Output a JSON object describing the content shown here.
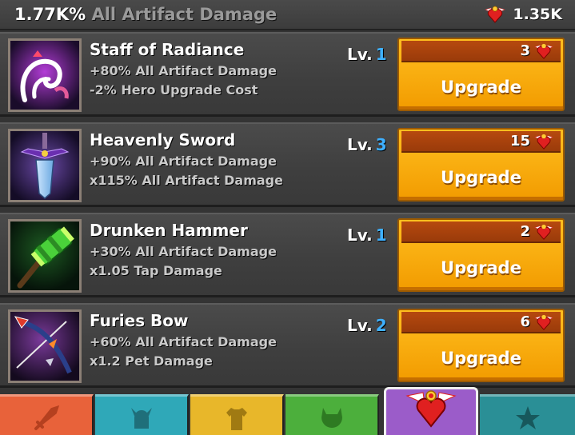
{
  "header": {
    "total_value": "1.77K%",
    "total_label": "All Artifact Damage",
    "currency_amount": "1.35K",
    "currency_icon": "winged-heart-relic-icon"
  },
  "artifacts": [
    {
      "name": "Staff of Radiance",
      "effect1": "+80% All Artifact Damage",
      "effect2": "-2% Hero Upgrade Cost",
      "level_label": "Lv.",
      "level": "1",
      "cost": "3",
      "button_label": "Upgrade",
      "icon": "staff-icon"
    },
    {
      "name": "Heavenly Sword",
      "effect1": "+90% All Artifact Damage",
      "effect2": "x115% All Artifact Damage",
      "level_label": "Lv.",
      "level": "3",
      "cost": "15",
      "button_label": "Upgrade",
      "icon": "sword-icon"
    },
    {
      "name": "Drunken Hammer",
      "effect1": "+30% All Artifact Damage",
      "effect2": "x1.05 Tap Damage",
      "level_label": "Lv.",
      "level": "1",
      "cost": "2",
      "button_label": "Upgrade",
      "icon": "hammer-icon"
    },
    {
      "name": "Furies Bow",
      "effect1": "+60% All Artifact Damage",
      "effect2": "x1.2 Pet Damage",
      "level_label": "Lv.",
      "level": "2",
      "cost": "6",
      "button_label": "Upgrade",
      "icon": "bow-icon"
    }
  ],
  "tabs": [
    {
      "icon": "sword-icon",
      "color": "#e8623a",
      "active": false
    },
    {
      "icon": "viking-helmet-icon",
      "color": "#2fa8b8",
      "active": false
    },
    {
      "icon": "shirt-icon",
      "color": "#e8b72a",
      "active": false
    },
    {
      "icon": "pet-head-icon",
      "color": "#4caf3c",
      "active": false
    },
    {
      "icon": "winged-heart-relic-icon",
      "color": "#9b5cc9",
      "active": true
    },
    {
      "icon": "star-icon",
      "color": "#2a8f96",
      "active": false
    }
  ],
  "colors": {
    "level_number": "#3eb0ff",
    "button_orange": "#f5a400",
    "cost_bar": "#a8420d"
  }
}
